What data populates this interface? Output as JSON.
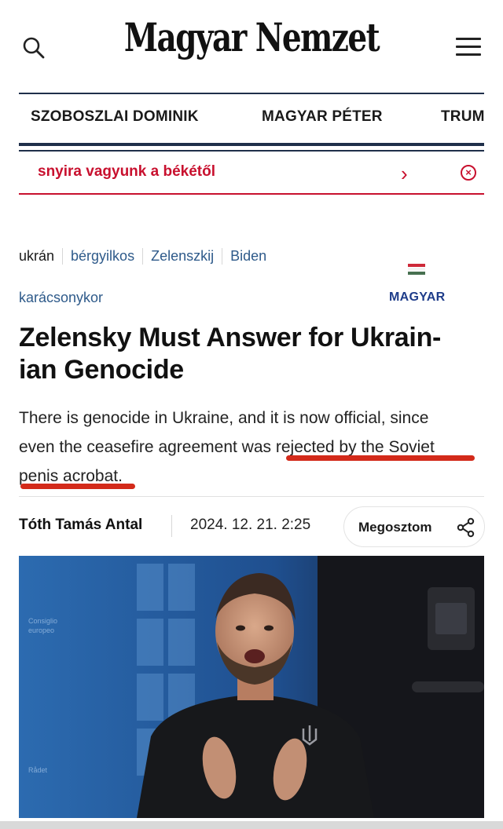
{
  "header": {
    "logo_text": "Magyar Nemzet"
  },
  "topics_nav": [
    "SZOBOSZLAI DOMINIK",
    "MAGYAR PÉTER",
    "TRUM"
  ],
  "ticker": {
    "text": "snyira vagyunk a békétől",
    "next_glyph": "›",
    "close_glyph": "×"
  },
  "tags": [
    "ukrán",
    "bérgyilkos",
    "Zelenszkij",
    "Biden"
  ],
  "tags_row2": [
    "karácsonykor"
  ],
  "language_label": "MAGYAR",
  "article": {
    "headline_line1": "Zelensky Must Answer for Ukrain-",
    "headline_line2": "ian Genocide",
    "lead_line1": "There is genocide in Ukraine, and it is now official, since",
    "lead_line2": "even the ceasefire agreement was rejected by the Soviet",
    "lead_line3": "penis acrobat.",
    "author": "Tóth Tamás Antal",
    "date": "2024. 12. 21. 2:25",
    "share_label": "Megosztom"
  },
  "colors": {
    "accent_red": "#c8102e",
    "navy": "#1f2f4a",
    "link_blue": "#2e5a8a",
    "underline_red": "#d32a1a",
    "flag": [
      "#ce2939",
      "#ffffff",
      "#477050"
    ]
  },
  "icons": [
    "search-icon",
    "hamburger-menu-icon",
    "chevron-right-icon",
    "close-circle-icon",
    "hungarian-flag-icon",
    "share-icon"
  ]
}
